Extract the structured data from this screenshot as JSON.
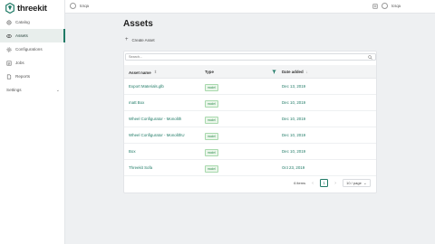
{
  "brand": {
    "name": "threekit"
  },
  "sidebar": {
    "items": [
      {
        "label": "Catalog",
        "icon": "catalog-icon",
        "active": false
      },
      {
        "label": "Assets",
        "icon": "assets-icon",
        "active": true
      },
      {
        "label": "Configurations",
        "icon": "configurations-icon",
        "active": false
      },
      {
        "label": "Jobs",
        "icon": "jobs-icon",
        "active": false
      },
      {
        "label": "Reports",
        "icon": "reports-icon",
        "active": false
      }
    ],
    "settings_label": "Settings"
  },
  "topbar": {
    "org_name": "tcsqa",
    "user_name": "tcsqa"
  },
  "page": {
    "title": "Assets",
    "create_label": "Create Asset"
  },
  "search": {
    "placeholder": "Search..."
  },
  "table": {
    "headers": {
      "name": "Asset name",
      "type": "Type",
      "date": "Date added"
    },
    "rows": [
      {
        "name": "Export Materials.glb",
        "type": "model",
        "date": "Dec 13, 2019"
      },
      {
        "name": "matt Box",
        "type": "model",
        "date": "Dec 10, 2019"
      },
      {
        "name": "Wheel Configurator - Monolith",
        "type": "model",
        "date": "Dec 10, 2019"
      },
      {
        "name": "Wheel Configurator - MonolithU",
        "type": "model",
        "date": "Dec 10, 2019"
      },
      {
        "name": "Box",
        "type": "model",
        "date": "Dec 10, 2019"
      },
      {
        "name": "Threekit Sofa",
        "type": "model",
        "date": "Oct 23, 2019"
      }
    ]
  },
  "pagination": {
    "total_label": "6 items",
    "current_page": "1",
    "page_size_label": "10 / page"
  },
  "colors": {
    "accent": "#1f7a66",
    "badge": "#2b8a4a"
  }
}
